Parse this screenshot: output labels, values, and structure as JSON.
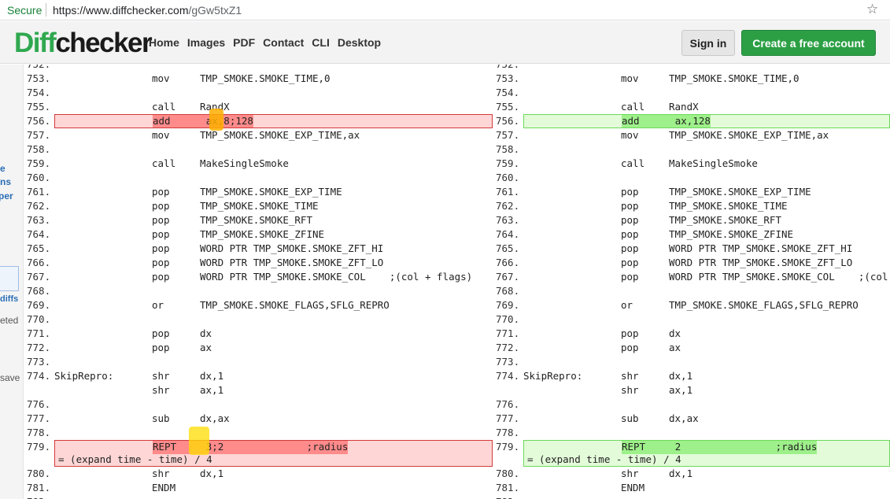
{
  "browser": {
    "secure_label": "Secure",
    "url_host": "https://www.diffchecker.com",
    "url_path": "/gGw5txZ1",
    "star_icon": "☆"
  },
  "header": {
    "logo_a": "Diff",
    "logo_b": "checker",
    "nav": [
      "Home",
      "Images",
      "PDF",
      "Contact",
      "CLI",
      "Desktop"
    ],
    "signin_label": "Sign in",
    "create_label": "Create a free account"
  },
  "sidebar": {
    "frag1": "e",
    "frag2": "ns",
    "frag3": "per",
    "frag4": "diffs",
    "frag5": "eted",
    "frag6": "save"
  },
  "colors": {
    "brand_green": "#2fa84f",
    "removed_bg": "#ffd6d6",
    "removed_highlight": "#ff8b8b",
    "added_bg": "#e3fbd9",
    "added_highlight": "#9ef08a"
  },
  "diff": {
    "left": [
      {
        "ln": "752.",
        "a": "",
        "b": "",
        "c": ""
      },
      {
        "ln": "753.",
        "a": "",
        "b": "mov",
        "c": "TMP_SMOKE.SMOKE_TIME,0"
      },
      {
        "ln": "754.",
        "a": "",
        "b": "",
        "c": ""
      },
      {
        "ln": "755.",
        "a": "",
        "b": "call",
        "c": "RandX"
      },
      {
        "ln": "756.",
        "type": "del",
        "a": "",
        "b": "add",
        "c": "ax,8;128",
        "hl": "add      ax,8;128"
      },
      {
        "ln": "757.",
        "a": "",
        "b": "mov",
        "c": "TMP_SMOKE.SMOKE_EXP_TIME,ax"
      },
      {
        "ln": "758.",
        "a": "",
        "b": "",
        "c": ""
      },
      {
        "ln": "759.",
        "a": "",
        "b": "call",
        "c": "MakeSingleSmoke"
      },
      {
        "ln": "760.",
        "a": "",
        "b": "",
        "c": ""
      },
      {
        "ln": "761.",
        "a": "",
        "b": "pop",
        "c": "TMP_SMOKE.SMOKE_EXP_TIME"
      },
      {
        "ln": "762.",
        "a": "",
        "b": "pop",
        "c": "TMP_SMOKE.SMOKE_TIME"
      },
      {
        "ln": "763.",
        "a": "",
        "b": "pop",
        "c": "TMP_SMOKE.SMOKE_RFT"
      },
      {
        "ln": "764.",
        "a": "",
        "b": "pop",
        "c": "TMP_SMOKE.SMOKE_ZFINE"
      },
      {
        "ln": "765.",
        "a": "",
        "b": "pop",
        "c": "WORD PTR TMP_SMOKE.SMOKE_ZFT_HI"
      },
      {
        "ln": "766.",
        "a": "",
        "b": "pop",
        "c": "WORD PTR TMP_SMOKE.SMOKE_ZFT_LO"
      },
      {
        "ln": "767.",
        "a": "",
        "b": "pop",
        "c": "WORD PTR TMP_SMOKE.SMOKE_COL    ;(col + flags)"
      },
      {
        "ln": "768.",
        "a": "",
        "b": "",
        "c": ""
      },
      {
        "ln": "769.",
        "a": "",
        "b": "or",
        "c": "TMP_SMOKE.SMOKE_FLAGS,SFLG_REPRO"
      },
      {
        "ln": "770.",
        "a": "",
        "b": "",
        "c": ""
      },
      {
        "ln": "771.",
        "a": "",
        "b": "pop",
        "c": "dx"
      },
      {
        "ln": "772.",
        "a": "",
        "b": "pop",
        "c": "ax"
      },
      {
        "ln": "773.",
        "a": "",
        "b": "",
        "c": ""
      },
      {
        "ln": "774.",
        "a": "SkipRepro:",
        "b": "shr",
        "c": "dx,1"
      },
      {
        "ln": "",
        "a": "",
        "b": "shr",
        "c": "ax,1"
      },
      {
        "ln": "776.",
        "a": "",
        "b": "",
        "c": ""
      },
      {
        "ln": "777.",
        "a": "",
        "b": "sub",
        "c": "dx,ax"
      },
      {
        "ln": "778.",
        "a": "",
        "b": "",
        "c": ""
      },
      {
        "ln": "779.",
        "type": "del",
        "wrap": true,
        "a": "",
        "b": "REPT",
        "c": "3;2              ;radius",
        "hl": "REPT     3;2              ;radius",
        "wrapline": "= (expand time - time) / 4"
      },
      {
        "ln": "780.",
        "a": "",
        "b": "shr",
        "c": "dx,1"
      },
      {
        "ln": "781.",
        "a": "",
        "b": "ENDM",
        "c": ""
      },
      {
        "ln": "782.",
        "a": "",
        "b": "",
        "c": ""
      }
    ],
    "right": [
      {
        "ln": "752.",
        "a": "",
        "b": "",
        "c": ""
      },
      {
        "ln": "753.",
        "a": "",
        "b": "mov",
        "c": "TMP_SMOKE.SMOKE_TIME,0"
      },
      {
        "ln": "754.",
        "a": "",
        "b": "",
        "c": ""
      },
      {
        "ln": "755.",
        "a": "",
        "b": "call",
        "c": "RandX"
      },
      {
        "ln": "756.",
        "type": "add",
        "a": "",
        "b": "add",
        "c": "ax,128",
        "hl": "add      ax,128"
      },
      {
        "ln": "757.",
        "a": "",
        "b": "mov",
        "c": "TMP_SMOKE.SMOKE_EXP_TIME,ax"
      },
      {
        "ln": "758.",
        "a": "",
        "b": "",
        "c": ""
      },
      {
        "ln": "759.",
        "a": "",
        "b": "call",
        "c": "MakeSingleSmoke"
      },
      {
        "ln": "760.",
        "a": "",
        "b": "",
        "c": ""
      },
      {
        "ln": "761.",
        "a": "",
        "b": "pop",
        "c": "TMP_SMOKE.SMOKE_EXP_TIME"
      },
      {
        "ln": "762.",
        "a": "",
        "b": "pop",
        "c": "TMP_SMOKE.SMOKE_TIME"
      },
      {
        "ln": "763.",
        "a": "",
        "b": "pop",
        "c": "TMP_SMOKE.SMOKE_RFT"
      },
      {
        "ln": "764.",
        "a": "",
        "b": "pop",
        "c": "TMP_SMOKE.SMOKE_ZFINE"
      },
      {
        "ln": "765.",
        "a": "",
        "b": "pop",
        "c": "WORD PTR TMP_SMOKE.SMOKE_ZFT_HI"
      },
      {
        "ln": "766.",
        "a": "",
        "b": "pop",
        "c": "WORD PTR TMP_SMOKE.SMOKE_ZFT_LO"
      },
      {
        "ln": "767.",
        "a": "",
        "b": "pop",
        "c": "WORD PTR TMP_SMOKE.SMOKE_COL    ;(col + flags)"
      },
      {
        "ln": "768.",
        "a": "",
        "b": "",
        "c": ""
      },
      {
        "ln": "769.",
        "a": "",
        "b": "or",
        "c": "TMP_SMOKE.SMOKE_FLAGS,SFLG_REPRO"
      },
      {
        "ln": "770.",
        "a": "",
        "b": "",
        "c": ""
      },
      {
        "ln": "771.",
        "a": "",
        "b": "pop",
        "c": "dx"
      },
      {
        "ln": "772.",
        "a": "",
        "b": "pop",
        "c": "ax"
      },
      {
        "ln": "773.",
        "a": "",
        "b": "",
        "c": ""
      },
      {
        "ln": "774.",
        "a": "SkipRepro:",
        "b": "shr",
        "c": "dx,1"
      },
      {
        "ln": "",
        "a": "",
        "b": "shr",
        "c": "ax,1"
      },
      {
        "ln": "776.",
        "a": "",
        "b": "",
        "c": ""
      },
      {
        "ln": "777.",
        "a": "",
        "b": "sub",
        "c": "dx,ax"
      },
      {
        "ln": "778.",
        "a": "",
        "b": "",
        "c": ""
      },
      {
        "ln": "779.",
        "type": "add",
        "wrap": true,
        "a": "",
        "b": "REPT",
        "c": "2                ;radius",
        "hl": "REPT     2                ;radius",
        "wrapline": "= (expand time - time) / 4"
      },
      {
        "ln": "780.",
        "a": "",
        "b": "shr",
        "c": "dx,1"
      },
      {
        "ln": "781.",
        "a": "",
        "b": "ENDM",
        "c": ""
      },
      {
        "ln": "782.",
        "a": "",
        "b": "",
        "c": ""
      }
    ]
  }
}
